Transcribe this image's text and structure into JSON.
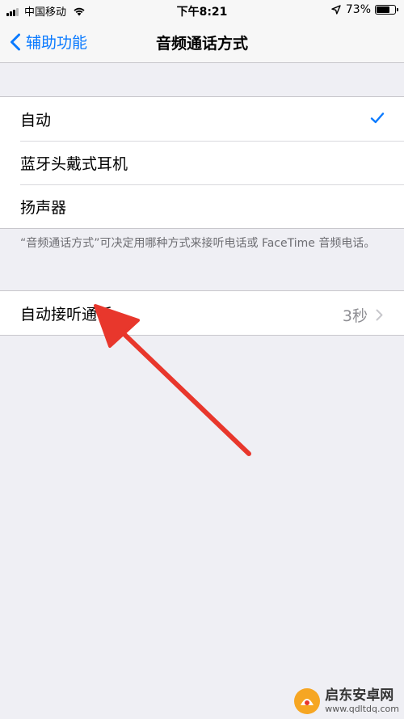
{
  "status_bar": {
    "carrier": "中国移动",
    "time": "下午8:21",
    "battery": "73%",
    "battery_level": 0.73
  },
  "nav": {
    "back_label": "辅助功能",
    "title": "音频通话方式"
  },
  "routing_options": [
    {
      "label": "自动",
      "selected": true
    },
    {
      "label": "蓝牙头戴式耳机",
      "selected": false
    },
    {
      "label": "扬声器",
      "selected": false
    }
  ],
  "footnote": "“音频通话方式”可决定用哪种方式来接听电话或 FaceTime 音频电话。",
  "auto_answer": {
    "label": "自动接听通话",
    "value": "3秒"
  },
  "watermark": {
    "name": "启东安卓网",
    "url": "www.qdltdq.com"
  },
  "colors": {
    "accent": "#0a7aff",
    "annotation": "#e8372c"
  }
}
